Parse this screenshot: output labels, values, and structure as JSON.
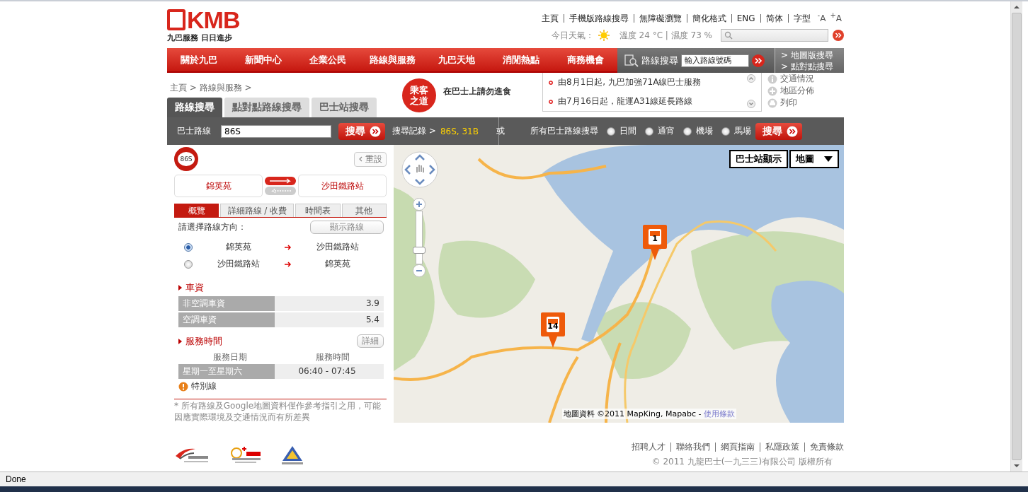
{
  "logo": {
    "mark": "KMB",
    "tagline": "九巴服務 日日進步"
  },
  "top_links": [
    "主頁",
    "手機版路線搜尋",
    "無障礙瀏覽",
    "簡化格式",
    "ENG",
    "简体",
    "字型"
  ],
  "font_buttons": [
    "$^{-}$A",
    "$^{+}$A"
  ],
  "weather": {
    "label": "今日天氣：",
    "reading": "溫度 24 °C | 濕度 73 %"
  },
  "nav": [
    "關於九巴",
    "新聞中心",
    "企業公民",
    "路線與服務",
    "九巴天地",
    "消閒熱點",
    "商務機會"
  ],
  "route_search": {
    "label": "路線搜尋",
    "placeholder": "輸入路線號碼"
  },
  "nav_links": [
    "> 地圖版搜尋",
    "> 點對點搜尋"
  ],
  "breadcrumb": "主頁 > 路線與服務 >",
  "search_tabs": [
    {
      "label": "路線搜尋",
      "selected": true
    },
    {
      "label": "點對點路線搜尋",
      "selected": false
    },
    {
      "label": "巴士站搜尋",
      "selected": false
    }
  ],
  "notice": {
    "badge": "乘客之道",
    "text": "在巴士上請勿進食"
  },
  "news": [
    "由8月1日起, 九巴加強71A線巴士服務",
    "由7月16日起，龍運A31線延長路線"
  ],
  "tools": [
    {
      "label": "交通情況",
      "kind": "info"
    },
    {
      "label": "地區分佈",
      "kind": "plus"
    },
    {
      "label": "列印",
      "kind": "print"
    }
  ],
  "search_bar": {
    "route_label": "巴士路線",
    "route_value": "86S",
    "search_button": "搜尋",
    "history_label": "搜尋記錄 >",
    "history": "86S, 31B",
    "or": "或",
    "all_label": "所有巴士路線搜尋",
    "search_button_2": "搜尋",
    "options": [
      {
        "label": "日間",
        "selected": false
      },
      {
        "label": "通宵",
        "selected": false
      },
      {
        "label": "機場",
        "selected": false
      },
      {
        "label": "馬場",
        "selected": false
      }
    ]
  },
  "route": {
    "number": "86S",
    "reset": "重設",
    "origin": "錦英苑",
    "destination": "沙田鐵路站"
  },
  "route_tabs": [
    {
      "label": "概覽",
      "selected": true
    },
    {
      "label": "詳細路線 / 收費",
      "selected": false
    },
    {
      "label": "時間表",
      "selected": false
    },
    {
      "label": "其他",
      "selected": false
    }
  ],
  "direction": {
    "prompt": "請選擇路線方向：",
    "show_button": "顯示路線",
    "options": [
      {
        "from": "錦英苑",
        "to": "沙田鐵路站",
        "selected": true
      },
      {
        "from": "沙田鐵路站",
        "to": "錦英苑",
        "selected": false
      }
    ]
  },
  "fares": {
    "title": "車資",
    "rows": [
      {
        "label": "非空調車資",
        "value": "3.9"
      },
      {
        "label": "空調車資",
        "value": "5.4"
      }
    ]
  },
  "service": {
    "title": "服務時間",
    "detail_button": "詳細",
    "columns": [
      "服務日期",
      "服務時間"
    ],
    "rows": [
      {
        "days": "星期一至星期六",
        "time": "06:40 - 07:45"
      }
    ]
  },
  "special": {
    "title": "特別線"
  },
  "disclaimer": "* 所有路線及Google地圖資料僅作參考指引之用，可能因應實際環境及交通情況而有所差異",
  "map": {
    "zoom": {
      "level": 0.25
    },
    "stop_toggle": "巴士站顯示",
    "type": "地圖",
    "markers": [
      {
        "label": "1"
      },
      {
        "label": "14"
      }
    ],
    "copyright": "地圖資料 ©2011 MapKing, Mapabc - ",
    "terms": "使用條款"
  },
  "footer": {
    "links": [
      "招聘人才",
      "聯絡我們",
      "網頁指南",
      "私隱政策",
      "免責條款"
    ],
    "copyright": "© 2011 九龍巴士(一九三三)有限公司 版權所有"
  },
  "status_bar": "Done"
}
